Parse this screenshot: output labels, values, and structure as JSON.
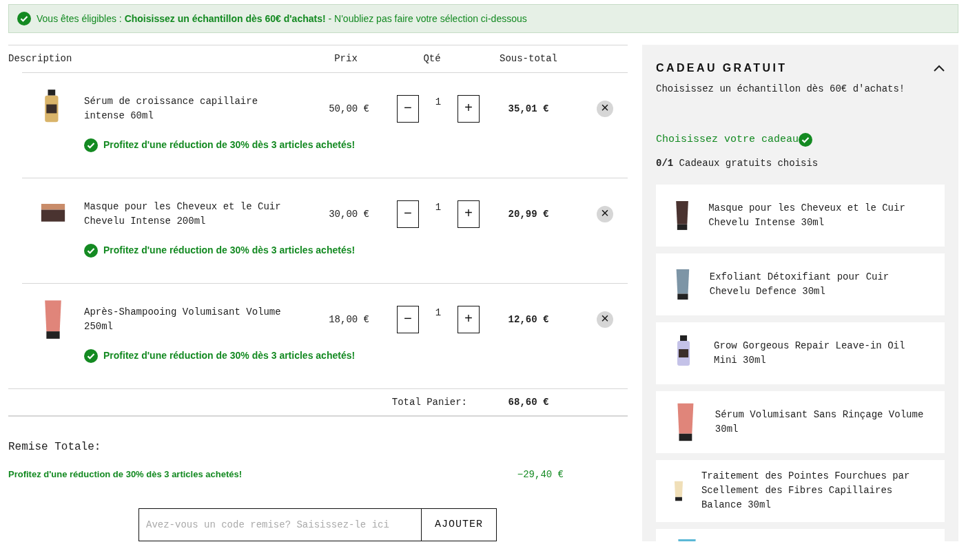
{
  "banner": {
    "text": "Vous êtes éligibles : **Choisissez un échantillon dès 60€ d'achats!** - N'oubliez pas faire votre sélection ci-dessous"
  },
  "cart": {
    "columns": [
      "Description",
      "Prix",
      "Qté",
      "Sous-total"
    ],
    "items": [
      {
        "name": "Sérum de croissance capillaire intense 60ml",
        "price": "50,00 €",
        "quantity": "1",
        "minus": "−",
        "plus": "+",
        "subtotal": "35,01 €",
        "remove": "×",
        "promo": "Profitez d'une réduction de 30% dès 3 articles achetés!",
        "image": {
          "kind": "bottle",
          "color": "#d9b46a"
        }
      },
      {
        "name": "Masque pour les Cheveux et le Cuir Chevelu Intense 200ml",
        "price": "30,00 €",
        "quantity": "1",
        "minus": "−",
        "plus": "+",
        "subtotal": "20,99 €",
        "remove": "×",
        "promo": "Profitez d'une réduction de 30% dès 3 articles achetés!",
        "image": {
          "kind": "jar",
          "color": "#4a3330"
        }
      },
      {
        "name": "Après-Shampooing Volumisant Volume 250ml",
        "price": "18,00 €",
        "quantity": "1",
        "minus": "−",
        "plus": "+",
        "subtotal": "12,60 €",
        "remove": "×",
        "promo": "Profitez d'une réduction de 30% dès 3 articles achetés!",
        "image": {
          "kind": "tube",
          "color": "#e0857a"
        }
      }
    ],
    "total_label": "Total Panier:",
    "total_value": "68,60 €"
  },
  "discount": {
    "title": "Remise Totale:",
    "label": "Profitez d'une réduction de 30% dès 3 articles achetés!",
    "amount": "−29,40 €"
  },
  "coupon": {
    "placeholder": "Avez-vous un code remise? Saisissez-le ici",
    "button": "AJOUTER"
  },
  "gift_panel": {
    "title": "CADEAU GRATUIT",
    "expanded": true,
    "subtitle": "Choisissez un échantillon dès 60€ d'achats!",
    "choose_label": "Choisissez votre cadeau",
    "count": "**0/1** Cadeaux gratuits choisis",
    "items": [
      {
        "name": "Masque pour les Cheveux et le Cuir Chevelu Intense 30ml",
        "image": {
          "kind": "tube",
          "color": "#4a3330"
        }
      },
      {
        "name": "Exfoliant Détoxifiant pour Cuir Chevelu Defence 30ml",
        "image": {
          "kind": "tube",
          "color": "#7d95a6"
        }
      },
      {
        "name": "Grow Gorgeous Repair Leave-in Oil Mini 30ml",
        "image": {
          "kind": "bottle",
          "color": "#c4c2e8"
        }
      },
      {
        "name": "Sérum Volumisant Sans Rinçage Volume 30ml",
        "image": {
          "kind": "tube",
          "color": "#e0857a"
        }
      },
      {
        "name": "Traitement des Pointes Fourchues par Scellement des Fibres Capillaires Balance 30ml",
        "image": {
          "kind": "tube",
          "color": "#f0dfb8"
        }
      },
      {
        "image": {
          "kind": "tube",
          "color": "#5bb8d6"
        }
      }
    ]
  }
}
